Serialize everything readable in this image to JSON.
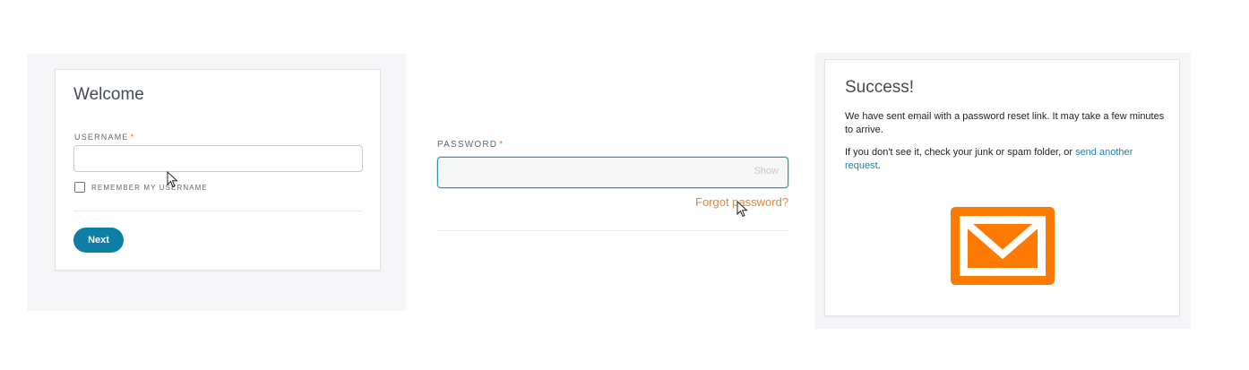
{
  "login_panel": {
    "title": "Welcome",
    "username_label": "USERNAME",
    "required_mark": "*",
    "username_value": "",
    "remember_label": "REMEMBER MY USERNAME",
    "next_button": "Next"
  },
  "password_panel": {
    "password_label": "PASSWORD",
    "required_mark": "*",
    "password_value": "",
    "show_label": "Show",
    "forgot_link": "Forgot password?"
  },
  "success_panel": {
    "title": "Success!",
    "message_1": "We have sent email with a password reset link. It may take a few minutes to arrive.",
    "message_2_prefix": "If you don't see it, check your junk or spam folder, or ",
    "resend_link": "send another request",
    "message_2_suffix": ".",
    "envelope_icon": "envelope-icon"
  },
  "colors": {
    "accent_blue": "#0e7ea6",
    "link_orange": "#e0873b",
    "required_orange": "#e0752b",
    "envelope_orange": "#ff7a00"
  }
}
